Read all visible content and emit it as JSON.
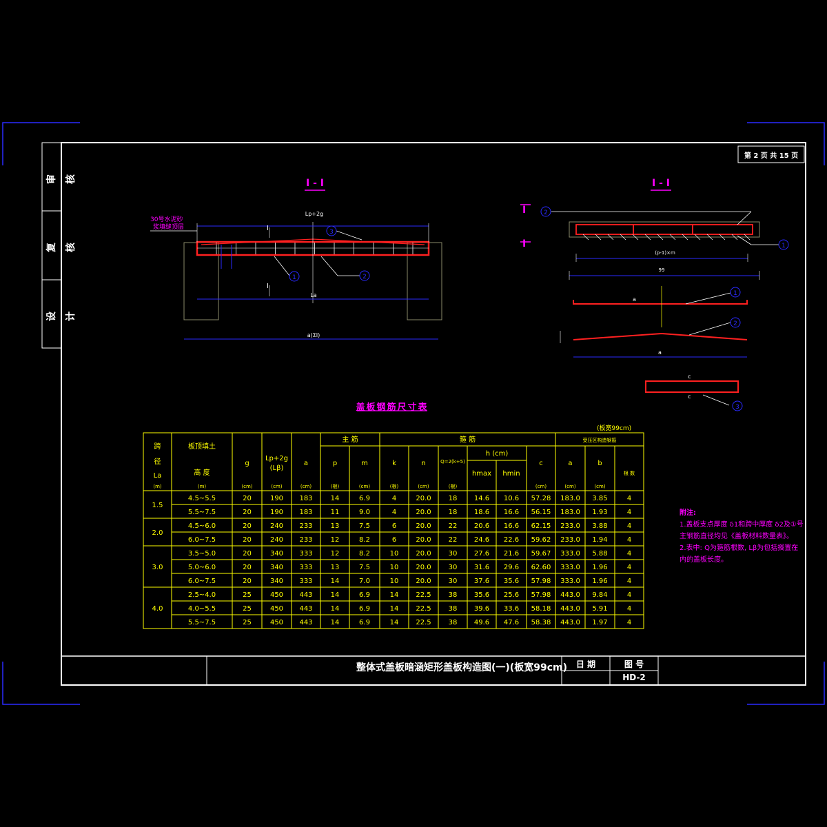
{
  "page": {
    "label": "第 2 页    共 15 页"
  },
  "side_stamp": [
    "审 核",
    "复 核",
    "设 计"
  ],
  "title_block": {
    "title": "整体式盖板暗涵矩形盖板构造图(一)(板宽99cm)",
    "date_label": "日  期",
    "drawing_no_label": "图  号",
    "drawing_no": "HD-2"
  },
  "left_view": {
    "title": "I - I",
    "annot1": "30号水泥砂",
    "annot2": "浆填缝顶层",
    "dim_top": "Lp+2g",
    "dim_bottom": "a(ΣI)",
    "dim_mid": "La",
    "marker": "I"
  },
  "right_view": {
    "title": "I - I",
    "marker": "I",
    "dim1": "(p-1)×m",
    "dim2": "99",
    "bar_labels": [
      "a",
      "a",
      "c",
      "c"
    ],
    "callouts": [
      "1",
      "2",
      "3"
    ]
  },
  "table": {
    "title": "盖板钢筋尺寸表",
    "note": "(板宽99cm)",
    "headers": {
      "col0": [
        "跨",
        "径",
        "La",
        "(m)"
      ],
      "col1": [
        "板顶填土",
        "高  度",
        "(m)"
      ],
      "g": "g",
      "lp": "Lp+2g",
      "lp2": "(Lβ)",
      "a": "a",
      "main": "主  筋",
      "p": "p",
      "m": "m",
      "stir": "箍  筋",
      "k": "k",
      "n": "n",
      "q": "Q=2(k+5)",
      "h": "h   (cm)",
      "hmax": "hmax",
      "hmin": "hmin",
      "c": "c",
      "pressure": "受压区构造钢筋",
      "a2": "a",
      "b": "b",
      "count": "根  数",
      "units": [
        "(cm)",
        "(cm)",
        "(cm)",
        "(根)",
        "(cm)",
        "(根)",
        "(cm)",
        "(根)",
        "(cm)",
        "(cm)",
        "(cm)"
      ]
    },
    "groups": [
      {
        "span": "1.5",
        "rows": [
          [
            "4.5~5.5",
            "20",
            "190",
            "183",
            "14",
            "6.9",
            "4",
            "20.0",
            "18",
            "14.6",
            "10.6",
            "57.28",
            "183.0",
            "3.85",
            "4"
          ],
          [
            "5.5~7.5",
            "20",
            "190",
            "183",
            "11",
            "9.0",
            "4",
            "20.0",
            "18",
            "18.6",
            "16.6",
            "56.15",
            "183.0",
            "1.93",
            "4"
          ]
        ]
      },
      {
        "span": "2.0",
        "rows": [
          [
            "4.5~6.0",
            "20",
            "240",
            "233",
            "13",
            "7.5",
            "6",
            "20.0",
            "22",
            "20.6",
            "16.6",
            "62.15",
            "233.0",
            "3.88",
            "4"
          ],
          [
            "6.0~7.5",
            "20",
            "240",
            "233",
            "12",
            "8.2",
            "6",
            "20.0",
            "22",
            "24.6",
            "22.6",
            "59.62",
            "233.0",
            "1.94",
            "4"
          ]
        ]
      },
      {
        "span": "3.0",
        "rows": [
          [
            "3.5~5.0",
            "20",
            "340",
            "333",
            "12",
            "8.2",
            "10",
            "20.0",
            "30",
            "27.6",
            "21.6",
            "59.67",
            "333.0",
            "5.88",
            "4"
          ],
          [
            "5.0~6.0",
            "20",
            "340",
            "333",
            "13",
            "7.5",
            "10",
            "20.0",
            "30",
            "31.6",
            "29.6",
            "62.60",
            "333.0",
            "1.96",
            "4"
          ],
          [
            "6.0~7.5",
            "20",
            "340",
            "333",
            "14",
            "7.0",
            "10",
            "20.0",
            "30",
            "37.6",
            "35.6",
            "57.98",
            "333.0",
            "1.96",
            "4"
          ]
        ]
      },
      {
        "span": "4.0",
        "rows": [
          [
            "2.5~4.0",
            "25",
            "450",
            "443",
            "14",
            "6.9",
            "14",
            "22.5",
            "38",
            "35.6",
            "25.6",
            "57.98",
            "443.0",
            "9.84",
            "4"
          ],
          [
            "4.0~5.5",
            "25",
            "450",
            "443",
            "14",
            "6.9",
            "14",
            "22.5",
            "38",
            "39.6",
            "33.6",
            "58.18",
            "443.0",
            "5.91",
            "4"
          ],
          [
            "5.5~7.5",
            "25",
            "450",
            "443",
            "14",
            "6.9",
            "14",
            "22.5",
            "38",
            "49.6",
            "47.6",
            "58.38",
            "443.0",
            "1.97",
            "4"
          ]
        ]
      }
    ]
  },
  "notes": {
    "title": "附注:",
    "lines": [
      "1.盖板支点厚度 δ1和跨中厚度 δ2及①号",
      "  主钢筋直径均见《盖板材料数量表》。",
      "2.表中: Q为箍筋根数, Lβ为包括搁置在",
      "  内的盖板长度。"
    ]
  },
  "colors": {
    "border": "#ffffff",
    "table": "#ffff00",
    "rebar": "#ff2020",
    "dims": "#2a2aff",
    "notes": "#ff00ff"
  }
}
